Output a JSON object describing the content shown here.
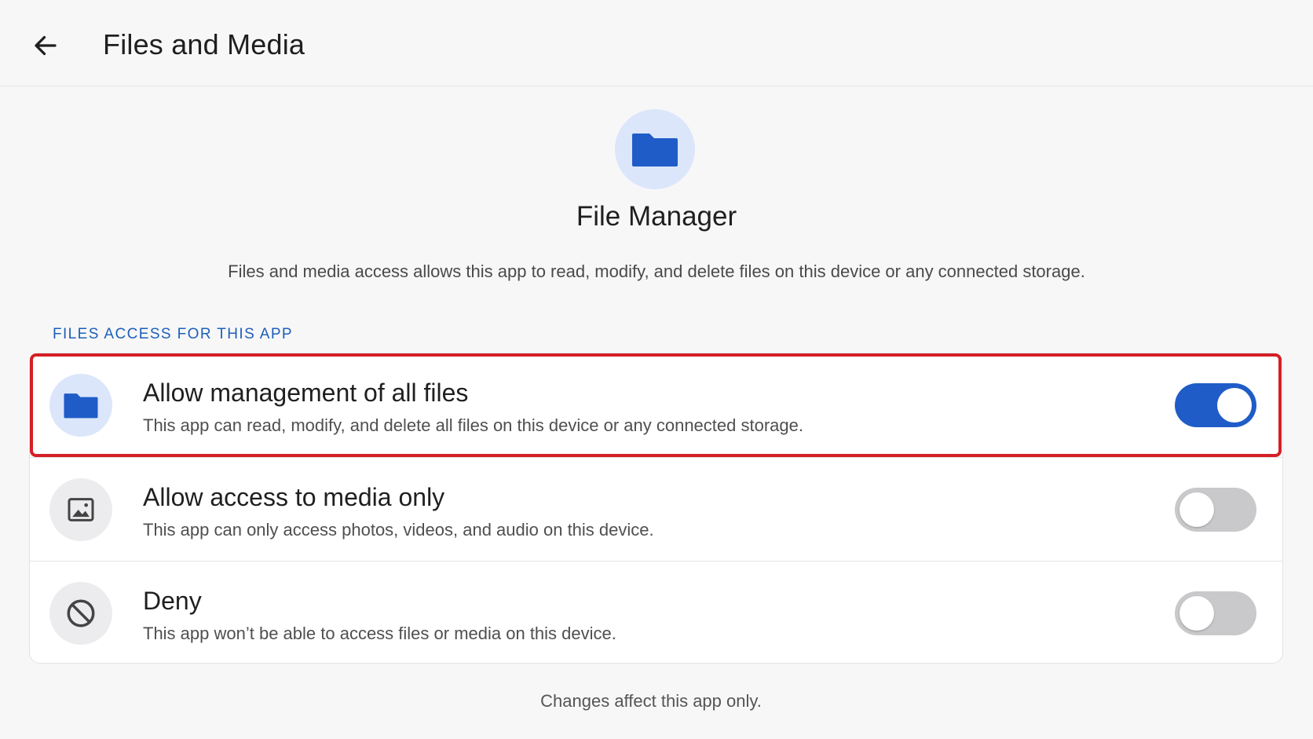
{
  "header": {
    "title": "Files and Media",
    "back_icon": "arrow-left-icon"
  },
  "app": {
    "name": "File Manager",
    "icon": "folder-icon",
    "description": "Files and media access allows this app to read, modify, and delete files on this device or any connected storage."
  },
  "section": {
    "label": "FILES ACCESS FOR THIS APP"
  },
  "options": [
    {
      "title": "Allow management of all files",
      "subtitle": "This app can read, modify, and delete all files on this device or any connected storage.",
      "icon": "folder-icon",
      "enabled": true
    },
    {
      "title": "Allow access to media only",
      "subtitle": "This app can only access photos, videos, and audio on this device.",
      "icon": "image-icon",
      "enabled": false
    },
    {
      "title": "Deny",
      "subtitle": "This app won’t be able to access files or media on this device.",
      "icon": "block-icon",
      "enabled": false
    }
  ],
  "footer": {
    "note": "Changes affect this app only."
  },
  "colors": {
    "accent": "#1f5cc8",
    "section_label": "#1d5fb8",
    "highlight": "#d51f26",
    "icon_bg_blue": "#dbe6fb",
    "toggle_off": "#c9c9cc"
  }
}
